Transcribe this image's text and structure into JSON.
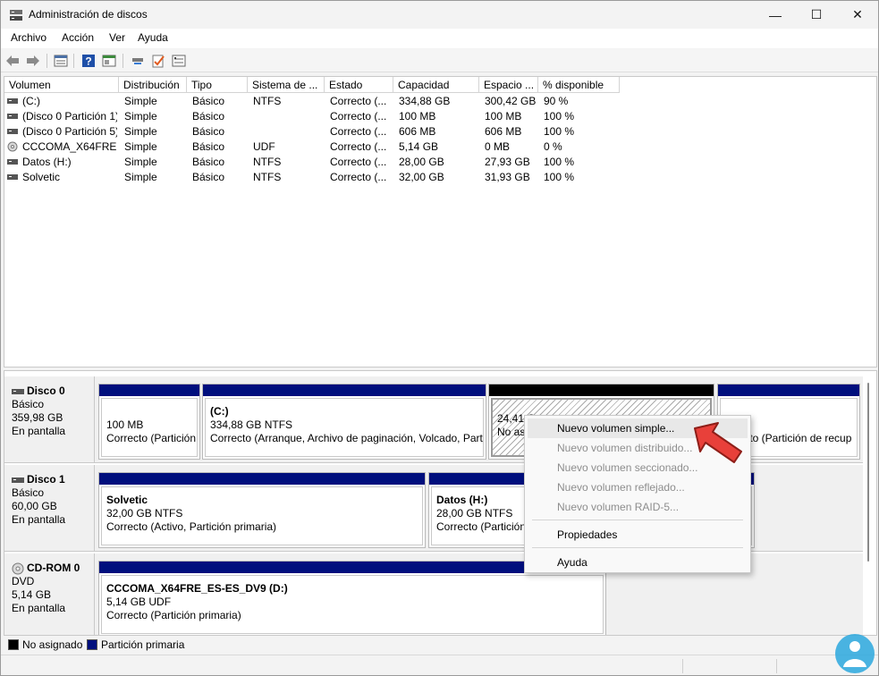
{
  "window": {
    "title": "Administración de discos",
    "controls": {
      "minimize": "—",
      "maximize": "☐",
      "close": "✕"
    }
  },
  "menu": [
    "Archivo",
    "Acción",
    "Ver",
    "Ayuda"
  ],
  "toolbar_icons": [
    "back-icon",
    "forward-icon",
    "properties-icon",
    "help-icon",
    "view-icon",
    "connect-icon",
    "check-icon",
    "settings-icon"
  ],
  "volume_list": {
    "columns": [
      "Volumen",
      "Distribución",
      "Tipo",
      "Sistema de ...",
      "Estado",
      "Capacidad",
      "Espacio ...",
      "% disponible"
    ],
    "rows": [
      [
        "(C:)",
        "Simple",
        "Básico",
        "NTFS",
        "Correcto (...",
        "334,88 GB",
        "300,42 GB",
        "90 %"
      ],
      [
        "(Disco 0 Partición 1)",
        "Simple",
        "Básico",
        "",
        "Correcto (...",
        "100 MB",
        "100 MB",
        "100 %"
      ],
      [
        "(Disco 0 Partición 5)",
        "Simple",
        "Básico",
        "",
        "Correcto (...",
        "606 MB",
        "606 MB",
        "100 %"
      ],
      [
        "CCCOMA_X64FRE...",
        "Simple",
        "Básico",
        "UDF",
        "Correcto (...",
        "5,14 GB",
        "0 MB",
        "0 %"
      ],
      [
        "Datos (H:)",
        "Simple",
        "Básico",
        "NTFS",
        "Correcto (...",
        "28,00 GB",
        "27,93 GB",
        "100 %"
      ],
      [
        "Solvetic",
        "Simple",
        "Básico",
        "NTFS",
        "Correcto (...",
        "32,00 GB",
        "31,93 GB",
        "100 %"
      ]
    ]
  },
  "disks": [
    {
      "name": "Disco 0",
      "type": "Básico",
      "size": "359,98 GB",
      "status": "En pantalla",
      "partitions": [
        {
          "title": "",
          "line1": "100 MB",
          "line2": "Correcto (Partición"
        },
        {
          "title": "(C:)",
          "line1": "334,88 GB NTFS",
          "line2": "Correcto (Arranque, Archivo de paginación, Volcado, Parti"
        },
        {
          "title": "",
          "line1": "24,41 G",
          "line2": "No asi"
        },
        {
          "title": "",
          "line1": "MB",
          "line2": "orrecto (Partición de recup"
        }
      ]
    },
    {
      "name": "Disco 1",
      "type": "Básico",
      "size": "60,00 GB",
      "status": "En pantalla",
      "partitions": [
        {
          "title": "Solvetic",
          "line1": "32,00 GB NTFS",
          "line2": "Correcto (Activo, Partición primaria)"
        },
        {
          "title": "Datos  (H:)",
          "line1": "28,00 GB NTFS",
          "line2": "Correcto (Partición"
        }
      ]
    },
    {
      "name": "CD-ROM 0",
      "type": "DVD",
      "size": "5,14 GB",
      "status": "En pantalla",
      "partitions": [
        {
          "title": "CCCOMA_X64FRE_ES-ES_DV9  (D:)",
          "line1": "5,14 GB UDF",
          "line2": "Correcto (Partición primaria)"
        }
      ]
    }
  ],
  "legend": [
    {
      "label": "No asignado",
      "color": "#000000"
    },
    {
      "label": "Partición primaria",
      "color": "#000f7d"
    }
  ],
  "context_menu": {
    "items": [
      {
        "label": "Nuevo volumen simple...",
        "enabled": true
      },
      {
        "label": "Nuevo volumen distribuido...",
        "enabled": false
      },
      {
        "label": "Nuevo volumen seccionado...",
        "enabled": false
      },
      {
        "label": "Nuevo volumen reflejado...",
        "enabled": false
      },
      {
        "label": "Nuevo volumen RAID-5...",
        "enabled": false
      },
      {
        "label": "Propiedades",
        "enabled": true
      },
      {
        "label": "Ayuda",
        "enabled": true
      }
    ]
  },
  "colors": {
    "primary_partition": "#000f7d",
    "unallocated": "#000000",
    "pointer": "#e8403a",
    "watermark": "#2aa7dd"
  }
}
